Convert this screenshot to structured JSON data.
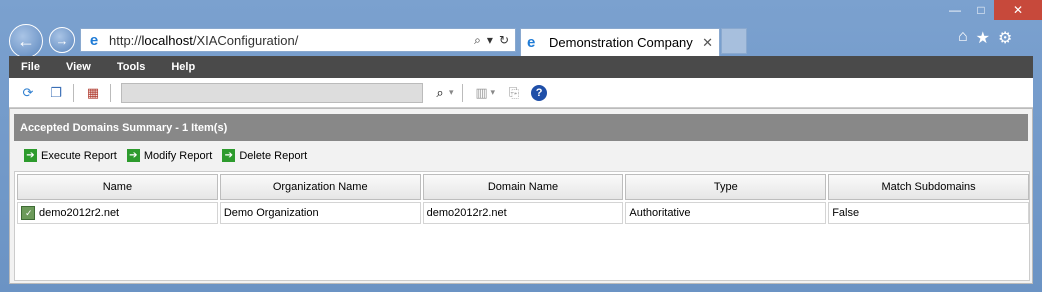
{
  "browser": {
    "url_prefix": "http://",
    "url_host": "localhost",
    "url_path": "/XIAConfiguration/",
    "tab_title": "Demonstration Company",
    "tab_close": "✕"
  },
  "menu": {
    "items": [
      "File",
      "View",
      "Tools",
      "Help"
    ]
  },
  "summary": {
    "title": "Accepted Domains Summary - 1 Item(s)"
  },
  "actions": {
    "execute": "Execute Report",
    "modify": "Modify Report",
    "delete": "Delete Report"
  },
  "table": {
    "headers": [
      "Name",
      "Organization Name",
      "Domain Name",
      "Type",
      "Match Subdomains"
    ],
    "rows": [
      [
        "demo2012r2.net",
        "Demo Organization",
        "demo2012r2.net",
        "Authoritative",
        "False"
      ]
    ]
  },
  "colors": {
    "menubar": "#4a4a4a",
    "summary_header": "#888888",
    "action_green": "#2d9b2d",
    "close_red": "#c7493b"
  }
}
